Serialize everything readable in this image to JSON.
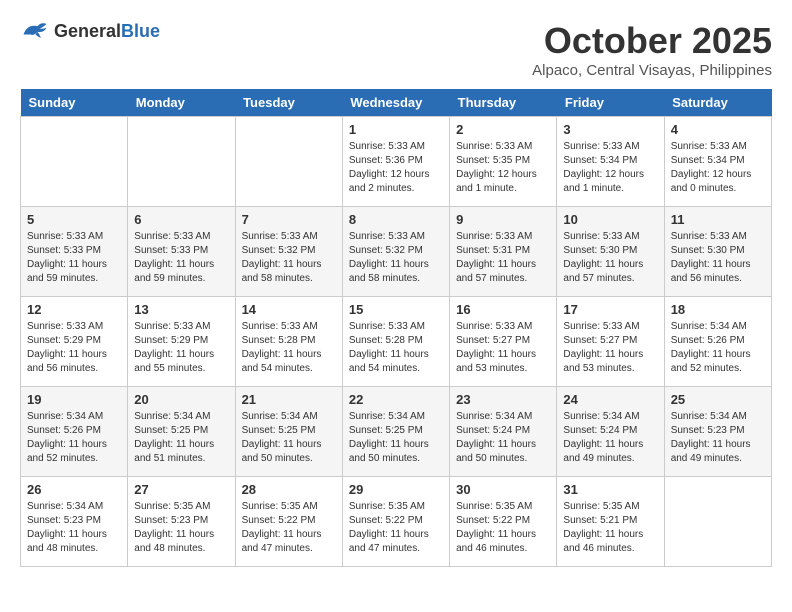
{
  "header": {
    "logo_general": "General",
    "logo_blue": "Blue",
    "month": "October 2025",
    "location": "Alpaco, Central Visayas, Philippines"
  },
  "weekdays": [
    "Sunday",
    "Monday",
    "Tuesday",
    "Wednesday",
    "Thursday",
    "Friday",
    "Saturday"
  ],
  "weeks": [
    [
      {
        "day": "",
        "info": ""
      },
      {
        "day": "",
        "info": ""
      },
      {
        "day": "",
        "info": ""
      },
      {
        "day": "1",
        "info": "Sunrise: 5:33 AM\nSunset: 5:36 PM\nDaylight: 12 hours\nand 2 minutes."
      },
      {
        "day": "2",
        "info": "Sunrise: 5:33 AM\nSunset: 5:35 PM\nDaylight: 12 hours\nand 1 minute."
      },
      {
        "day": "3",
        "info": "Sunrise: 5:33 AM\nSunset: 5:34 PM\nDaylight: 12 hours\nand 1 minute."
      },
      {
        "day": "4",
        "info": "Sunrise: 5:33 AM\nSunset: 5:34 PM\nDaylight: 12 hours\nand 0 minutes."
      }
    ],
    [
      {
        "day": "5",
        "info": "Sunrise: 5:33 AM\nSunset: 5:33 PM\nDaylight: 11 hours\nand 59 minutes."
      },
      {
        "day": "6",
        "info": "Sunrise: 5:33 AM\nSunset: 5:33 PM\nDaylight: 11 hours\nand 59 minutes."
      },
      {
        "day": "7",
        "info": "Sunrise: 5:33 AM\nSunset: 5:32 PM\nDaylight: 11 hours\nand 58 minutes."
      },
      {
        "day": "8",
        "info": "Sunrise: 5:33 AM\nSunset: 5:32 PM\nDaylight: 11 hours\nand 58 minutes."
      },
      {
        "day": "9",
        "info": "Sunrise: 5:33 AM\nSunset: 5:31 PM\nDaylight: 11 hours\nand 57 minutes."
      },
      {
        "day": "10",
        "info": "Sunrise: 5:33 AM\nSunset: 5:30 PM\nDaylight: 11 hours\nand 57 minutes."
      },
      {
        "day": "11",
        "info": "Sunrise: 5:33 AM\nSunset: 5:30 PM\nDaylight: 11 hours\nand 56 minutes."
      }
    ],
    [
      {
        "day": "12",
        "info": "Sunrise: 5:33 AM\nSunset: 5:29 PM\nDaylight: 11 hours\nand 56 minutes."
      },
      {
        "day": "13",
        "info": "Sunrise: 5:33 AM\nSunset: 5:29 PM\nDaylight: 11 hours\nand 55 minutes."
      },
      {
        "day": "14",
        "info": "Sunrise: 5:33 AM\nSunset: 5:28 PM\nDaylight: 11 hours\nand 54 minutes."
      },
      {
        "day": "15",
        "info": "Sunrise: 5:33 AM\nSunset: 5:28 PM\nDaylight: 11 hours\nand 54 minutes."
      },
      {
        "day": "16",
        "info": "Sunrise: 5:33 AM\nSunset: 5:27 PM\nDaylight: 11 hours\nand 53 minutes."
      },
      {
        "day": "17",
        "info": "Sunrise: 5:33 AM\nSunset: 5:27 PM\nDaylight: 11 hours\nand 53 minutes."
      },
      {
        "day": "18",
        "info": "Sunrise: 5:34 AM\nSunset: 5:26 PM\nDaylight: 11 hours\nand 52 minutes."
      }
    ],
    [
      {
        "day": "19",
        "info": "Sunrise: 5:34 AM\nSunset: 5:26 PM\nDaylight: 11 hours\nand 52 minutes."
      },
      {
        "day": "20",
        "info": "Sunrise: 5:34 AM\nSunset: 5:25 PM\nDaylight: 11 hours\nand 51 minutes."
      },
      {
        "day": "21",
        "info": "Sunrise: 5:34 AM\nSunset: 5:25 PM\nDaylight: 11 hours\nand 50 minutes."
      },
      {
        "day": "22",
        "info": "Sunrise: 5:34 AM\nSunset: 5:25 PM\nDaylight: 11 hours\nand 50 minutes."
      },
      {
        "day": "23",
        "info": "Sunrise: 5:34 AM\nSunset: 5:24 PM\nDaylight: 11 hours\nand 50 minutes."
      },
      {
        "day": "24",
        "info": "Sunrise: 5:34 AM\nSunset: 5:24 PM\nDaylight: 11 hours\nand 49 minutes."
      },
      {
        "day": "25",
        "info": "Sunrise: 5:34 AM\nSunset: 5:23 PM\nDaylight: 11 hours\nand 49 minutes."
      }
    ],
    [
      {
        "day": "26",
        "info": "Sunrise: 5:34 AM\nSunset: 5:23 PM\nDaylight: 11 hours\nand 48 minutes."
      },
      {
        "day": "27",
        "info": "Sunrise: 5:35 AM\nSunset: 5:23 PM\nDaylight: 11 hours\nand 48 minutes."
      },
      {
        "day": "28",
        "info": "Sunrise: 5:35 AM\nSunset: 5:22 PM\nDaylight: 11 hours\nand 47 minutes."
      },
      {
        "day": "29",
        "info": "Sunrise: 5:35 AM\nSunset: 5:22 PM\nDaylight: 11 hours\nand 47 minutes."
      },
      {
        "day": "30",
        "info": "Sunrise: 5:35 AM\nSunset: 5:22 PM\nDaylight: 11 hours\nand 46 minutes."
      },
      {
        "day": "31",
        "info": "Sunrise: 5:35 AM\nSunset: 5:21 PM\nDaylight: 11 hours\nand 46 minutes."
      },
      {
        "day": "",
        "info": ""
      }
    ]
  ]
}
